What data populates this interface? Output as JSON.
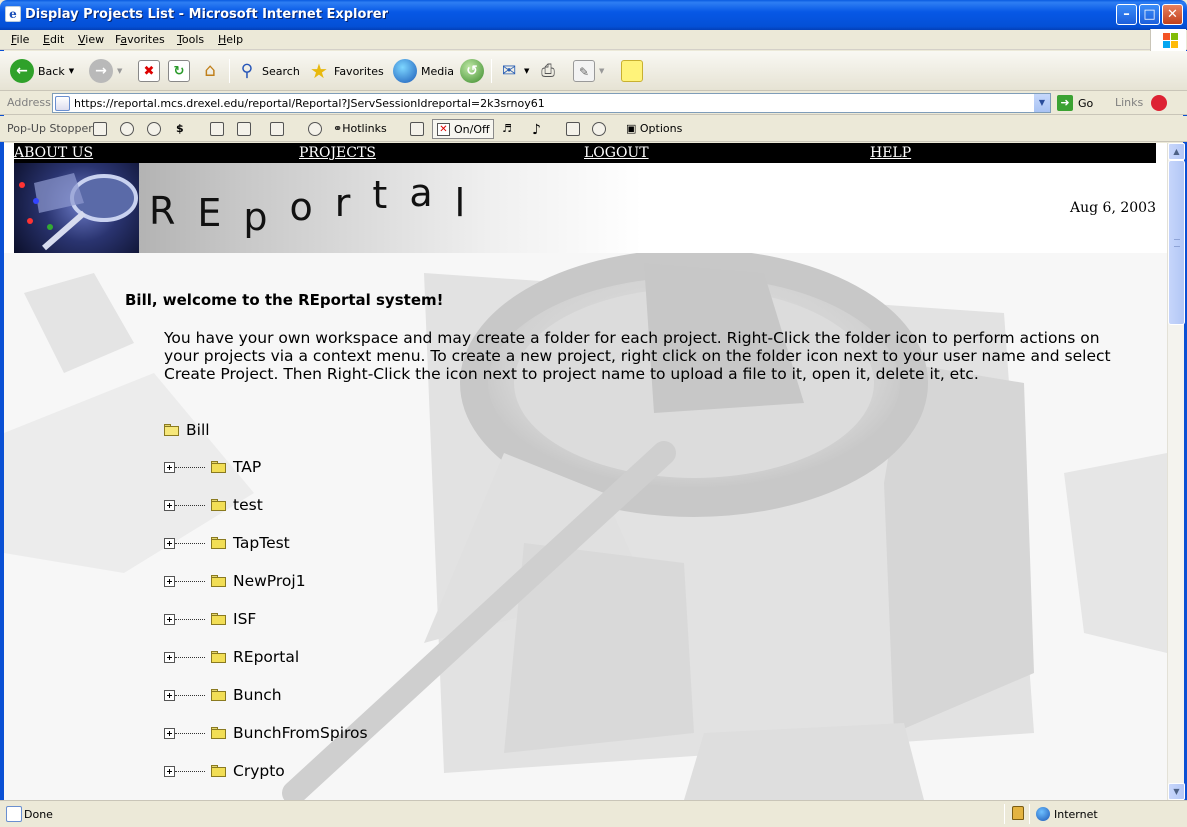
{
  "window": {
    "title": "Display Projects List - Microsoft Internet Explorer",
    "btn_min": "–",
    "btn_max": "□",
    "btn_close": "✕"
  },
  "menu": {
    "items": [
      {
        "key": "F",
        "rest": "ile"
      },
      {
        "key": "E",
        "rest": "dit"
      },
      {
        "key": "V",
        "rest": "iew"
      },
      {
        "key": "",
        "pre": "F",
        "mid": "a",
        "rest": "vorites"
      },
      {
        "key": "T",
        "rest": "ools"
      },
      {
        "key": "H",
        "rest": "elp"
      }
    ]
  },
  "toolbar": {
    "back": "Back",
    "search": "Search",
    "favorites": "Favorites",
    "media": "Media"
  },
  "address": {
    "label": "Address",
    "url": "https://reportal.mcs.drexel.edu/reportal/Reportal?JServSessionIdreportal=2k3srnoy61",
    "go": "Go",
    "links": "Links"
  },
  "popup_stopper": {
    "label": "Pop-Up Stopper",
    "hotlinks": "Hotlinks",
    "onoff": "On/Off",
    "options": "Options"
  },
  "page": {
    "nav": {
      "about": "ABOUT US",
      "projects": "PROJECTS",
      "logout": "LOGOUT",
      "help": "HELP"
    },
    "banner": {
      "title_letters": [
        "R",
        "E",
        "p",
        "o",
        "r",
        "t",
        "a",
        "l"
      ],
      "date": "Aug 6, 2003"
    },
    "welcome": "Bill, welcome to the REportal system!",
    "intro": "You have your own workspace and may create a folder for each project. Right-Click the folder icon to perform actions on your projects via a context menu. To create a new project, right click on the folder icon next to your user name and select Create Project. Then Right-Click the icon next to project name to upload a file to it, open it, delete it, etc.",
    "root_user": "Bill",
    "projects": [
      "TAP",
      "test",
      "TapTest",
      "NewProj1",
      "ISF",
      "REportal",
      "Bunch",
      "BunchFromSpiros",
      "Crypto"
    ]
  },
  "status": {
    "text": "Done",
    "zone": "Internet"
  }
}
